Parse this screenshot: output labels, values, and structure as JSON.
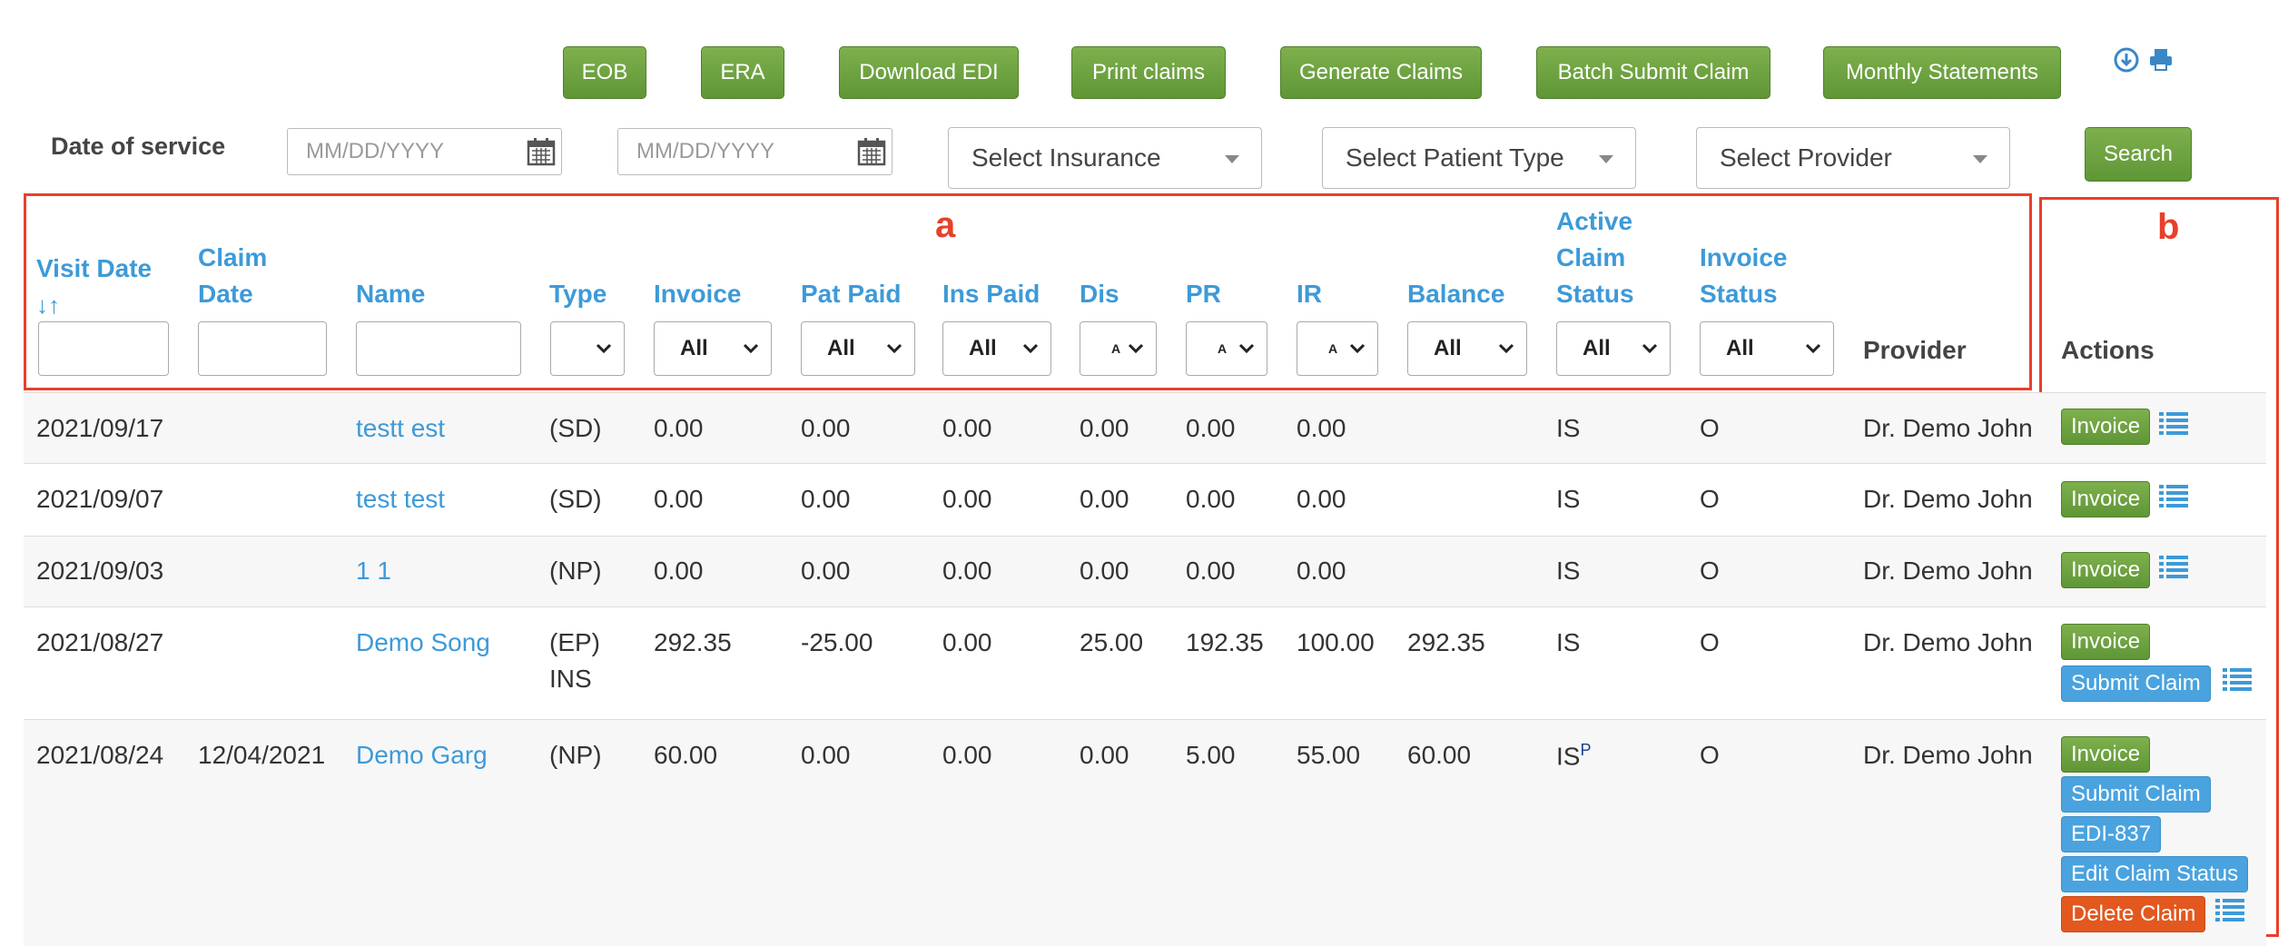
{
  "toolbar": {
    "eob": "EOB",
    "era": "ERA",
    "download_edi": "Download EDI",
    "print_claims": "Print claims",
    "generate_claims": "Generate Claims",
    "batch_submit": "Batch Submit Claim",
    "monthly_statements": "Monthly Statements",
    "icons": [
      "download-icon",
      "print-icon"
    ]
  },
  "filters": {
    "date_label": "Date of service",
    "date_from_placeholder": "MM/DD/YYYY",
    "date_to_placeholder": "MM/DD/YYYY",
    "insurance": "Select Insurance",
    "patient_type": "Select Patient Type",
    "provider": "Select Provider",
    "search": "Search"
  },
  "annotations": {
    "a": "a",
    "b": "b",
    "color": "#e8402a"
  },
  "columns": {
    "visit_date": "Visit Date",
    "sort_icon": "↓↑",
    "claim_date_1": "Claim",
    "claim_date_2": "Date",
    "name": "Name",
    "type": "Type",
    "invoice": "Invoice",
    "pat_paid": "Pat Paid",
    "ins_paid": "Ins Paid",
    "dis": "Dis",
    "pr": "PR",
    "ir": "IR",
    "balance": "Balance",
    "active_1": "Active",
    "active_2": "Claim",
    "active_3": "Status",
    "invoice_status_1": "Invoice",
    "invoice_status_2": "Status",
    "provider": "Provider",
    "actions": "Actions"
  },
  "column_filters": {
    "invoice": "All",
    "pat_paid": "All",
    "ins_paid": "All",
    "dis": "A",
    "pr": "A",
    "ir": "A",
    "balance": "All",
    "active_status": "All",
    "invoice_status": "All"
  },
  "rows": [
    {
      "visit": "2021/09/17",
      "claim": "",
      "name": "testt est",
      "type": "(SD)",
      "type2": "",
      "invoice": "0.00",
      "pat_paid": "0.00",
      "ins_paid": "0.00",
      "dis": "0.00",
      "pr": "0.00",
      "ir": "0.00",
      "balance": "",
      "status": "IS",
      "status_sup": "",
      "inv_status": "O",
      "provider": "Dr. Demo John"
    },
    {
      "visit": "2021/09/07",
      "claim": "",
      "name": "test test",
      "type": "(SD)",
      "type2": "",
      "invoice": "0.00",
      "pat_paid": "0.00",
      "ins_paid": "0.00",
      "dis": "0.00",
      "pr": "0.00",
      "ir": "0.00",
      "balance": "",
      "status": "IS",
      "status_sup": "",
      "inv_status": "O",
      "provider": "Dr. Demo John"
    },
    {
      "visit": "2021/09/03",
      "claim": "",
      "name": "1 1",
      "type": "(NP)",
      "type2": "",
      "invoice": "0.00",
      "pat_paid": "0.00",
      "ins_paid": "0.00",
      "dis": "0.00",
      "pr": "0.00",
      "ir": "0.00",
      "balance": "",
      "status": "IS",
      "status_sup": "",
      "inv_status": "O",
      "provider": "Dr. Demo John"
    },
    {
      "visit": "2021/08/27",
      "claim": "",
      "name": "Demo Song",
      "type": "(EP)",
      "type2": "INS",
      "invoice": "292.35",
      "pat_paid": "-25.00",
      "ins_paid": "0.00",
      "dis": "25.00",
      "pr": "192.35",
      "ir": "100.00",
      "balance": "292.35",
      "status": "IS",
      "status_sup": "",
      "inv_status": "O",
      "provider": "Dr. Demo John"
    },
    {
      "visit": "2021/08/24",
      "claim": "12/04/2021",
      "name": "Demo Garg",
      "type": "(NP)",
      "type2": "",
      "invoice": "60.00",
      "pat_paid": "0.00",
      "ins_paid": "0.00",
      "dis": "0.00",
      "pr": "5.00",
      "ir": "55.00",
      "balance": "60.00",
      "status": "IS",
      "status_sup": "P",
      "inv_status": "O",
      "provider": "Dr. Demo John"
    }
  ],
  "actions": {
    "invoice": "Invoice",
    "submit_claim": "Submit Claim",
    "edi": "EDI-837",
    "edit_status": "Edit Claim Status",
    "delete": "Delete Claim"
  }
}
